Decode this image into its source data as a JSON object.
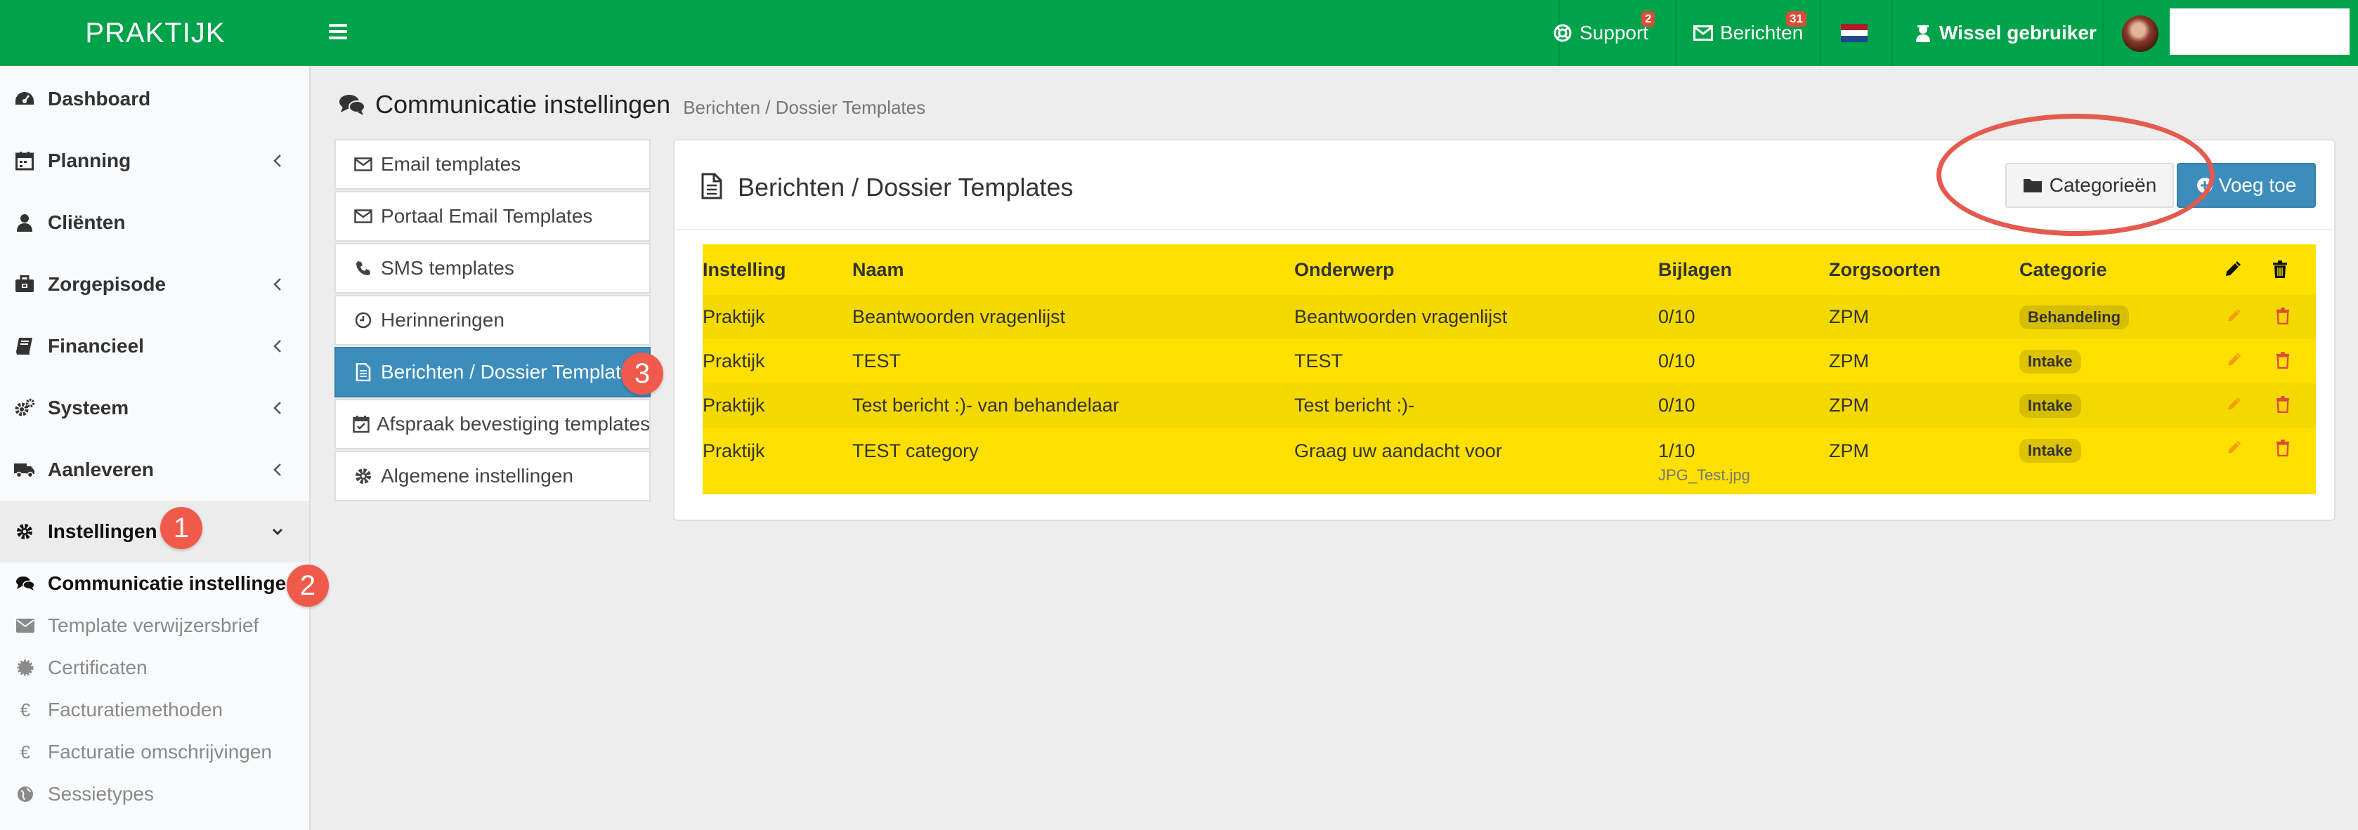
{
  "topbar": {
    "brand": "PRAKTIJK",
    "support_label": "Support",
    "support_count": "2",
    "messages_label": "Berichten",
    "messages_count": "31",
    "switch_user_label": "Wissel gebruiker",
    "user_name": ""
  },
  "sidebar": {
    "items": [
      {
        "label": "Dashboard",
        "icon": "dashboard-icon"
      },
      {
        "label": "Planning",
        "icon": "calendar-icon"
      },
      {
        "label": "Cliënten",
        "icon": "user-icon"
      },
      {
        "label": "Zorgepisode",
        "icon": "briefcase-icon"
      },
      {
        "label": "Financieel",
        "icon": "book-icon"
      },
      {
        "label": "Systeem",
        "icon": "cogs-icon"
      },
      {
        "label": "Aanleveren",
        "icon": "truck-icon"
      },
      {
        "label": "Instellingen",
        "icon": "gear-icon"
      }
    ],
    "subitems": [
      {
        "label": "Communicatie instellingen",
        "icon": "comments-icon"
      },
      {
        "label": "Template verwijzersbrief",
        "icon": "envelope-icon"
      },
      {
        "label": "Certificaten",
        "icon": "certificate-icon"
      },
      {
        "label": "Facturatiemethoden",
        "icon": "euro-icon"
      },
      {
        "label": "Facturatie omschrijvingen",
        "icon": "euro-icon"
      },
      {
        "label": "Sessietypes",
        "icon": "globe-icon"
      }
    ]
  },
  "steps": [
    "1",
    "2",
    "3"
  ],
  "page": {
    "title": "Communicatie instellingen",
    "breadcrumb": "Berichten / Dossier Templates"
  },
  "submenu": [
    {
      "label": "Email templates",
      "icon": "envelope-icon"
    },
    {
      "label": "Portaal Email Templates",
      "icon": "envelope-icon"
    },
    {
      "label": "SMS templates",
      "icon": "phone-icon"
    },
    {
      "label": "Herinneringen",
      "icon": "clock-icon"
    },
    {
      "label": "Berichten / Dossier Templates",
      "icon": "file-text-icon"
    },
    {
      "label": "Afspraak bevestiging templates",
      "icon": "calendar-check-icon"
    },
    {
      "label": "Algemene instellingen",
      "icon": "gear-icon"
    }
  ],
  "panel": {
    "title": "Berichten / Dossier Templates",
    "categories_button": "Categorieën",
    "add_button": "Voeg toe"
  },
  "table": {
    "headers": [
      "Instelling",
      "Naam",
      "Onderwerp",
      "Bijlagen",
      "Zorgsoorten",
      "Categorie"
    ],
    "rows": [
      {
        "instelling": "Praktijk",
        "naam": "Beantwoorden vragenlijst",
        "onderwerp": "Beantwoorden vragenlijst",
        "bijlagen": "0/10",
        "attachment": "",
        "zorgsoorten": "ZPM",
        "categorie": "Behandeling"
      },
      {
        "instelling": "Praktijk",
        "naam": "TEST",
        "onderwerp": "TEST",
        "bijlagen": "0/10",
        "attachment": "",
        "zorgsoorten": "ZPM",
        "categorie": "Intake"
      },
      {
        "instelling": "Praktijk",
        "naam": "Test bericht :)- van behandelaar",
        "onderwerp": "Test bericht :)-",
        "bijlagen": "0/10",
        "attachment": "",
        "zorgsoorten": "ZPM",
        "categorie": "Intake"
      },
      {
        "instelling": "Praktijk",
        "naam": "TEST category",
        "onderwerp": "Graag uw aandacht voor",
        "bijlagen": "1/10",
        "attachment": "JPG_Test.jpg",
        "zorgsoorten": "ZPM",
        "categorie": "Intake"
      }
    ]
  },
  "colors": {
    "topbar": "#00a24a",
    "primary": "#3c8dbc",
    "highlight": "#fde000",
    "annotation": "#e45a4f",
    "edit_icon": "#f39c12",
    "delete_icon": "#dd4b39"
  }
}
